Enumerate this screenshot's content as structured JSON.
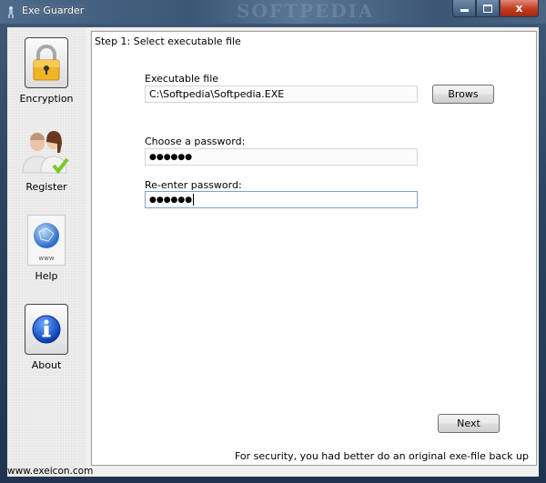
{
  "window": {
    "title": "Exe Guarder",
    "watermark": "SOFTPEDIA",
    "controls": {
      "minimize": "minimize",
      "maximize": "maximize",
      "close": "x"
    }
  },
  "sidebar": {
    "items": [
      {
        "label": "Encryption",
        "icon": "padlock-icon"
      },
      {
        "label": "Register",
        "icon": "users-check-icon"
      },
      {
        "label": "Help",
        "icon": "globe-www-icon"
      },
      {
        "label": "About",
        "icon": "info-icon"
      }
    ],
    "footer_link": "www.exeicon.com",
    "help_icon_caption": "www"
  },
  "main": {
    "step_title": "Step 1: Select executable file",
    "executable": {
      "label": "Executable file",
      "value": "C:\\Softpedia\\Softpedia.EXE",
      "browse_label": "Brows"
    },
    "password": {
      "label": "Choose a password:",
      "masked_value": "●●●●●●"
    },
    "reenter": {
      "label": "Re-enter password:",
      "masked_value": "●●●●●●"
    },
    "next_label": "Next",
    "hint": "For security, you had better do an original exe-file back up"
  },
  "colors": {
    "titlebar": "#3c5776",
    "close_button": "#c43a1e",
    "focus_border": "#7da2ce",
    "lock_gold": "#f0b428",
    "info_blue": "#1f5fd6"
  }
}
